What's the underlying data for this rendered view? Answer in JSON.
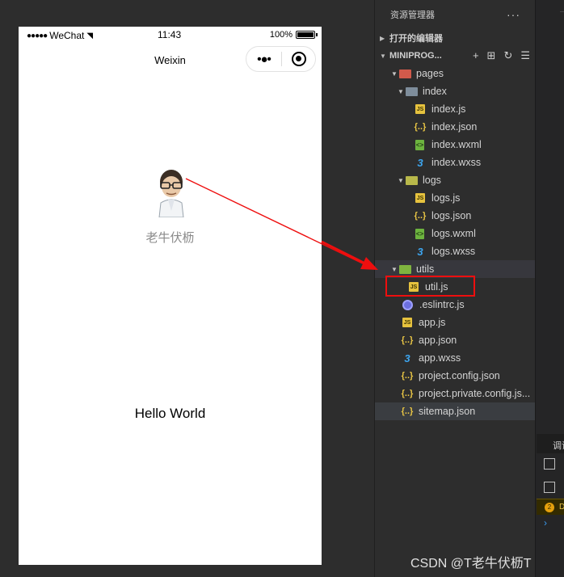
{
  "simulator": {
    "status": {
      "carrier": "WeChat",
      "time": "11:43",
      "battery": "100%"
    },
    "nav_title": "Weixin",
    "nickname": "老牛伏枥",
    "hello": "Hello World"
  },
  "explorer": {
    "title": "资源管理器",
    "more": "···",
    "open_editors": "打开的编辑器",
    "project": "MINIPROG...",
    "items": [
      {
        "label": "pages",
        "icon": "folder-icon"
      },
      {
        "label": "index",
        "icon": "folder-icon"
      },
      {
        "label": "index.js",
        "icon": "js-file-icon"
      },
      {
        "label": "index.json",
        "icon": "json-file-icon"
      },
      {
        "label": "index.wxml",
        "icon": "wxml-file-icon"
      },
      {
        "label": "index.wxss",
        "icon": "wxss-file-icon"
      },
      {
        "label": "logs",
        "icon": "folder-icon"
      },
      {
        "label": "logs.js",
        "icon": "js-file-icon"
      },
      {
        "label": "logs.json",
        "icon": "json-file-icon"
      },
      {
        "label": "logs.wxml",
        "icon": "wxml-file-icon"
      },
      {
        "label": "logs.wxss",
        "icon": "wxss-file-icon"
      },
      {
        "label": "utils",
        "icon": "folder-icon"
      },
      {
        "label": "util.js",
        "icon": "js-file-icon"
      },
      {
        "label": ".eslintrc.js",
        "icon": "eslint-icon"
      },
      {
        "label": "app.js",
        "icon": "js-file-icon"
      },
      {
        "label": "app.json",
        "icon": "json-file-icon"
      },
      {
        "label": "app.wxss",
        "icon": "wxss-file-icon"
      },
      {
        "label": "project.config.json",
        "icon": "json-file-icon"
      },
      {
        "label": "project.private.config.js...",
        "icon": "json-file-icon"
      },
      {
        "label": "sitemap.json",
        "icon": "json-file-icon"
      }
    ]
  },
  "right_panel": {
    "tab": "调试",
    "warning": "D"
  },
  "watermark": "CSDN @T老牛伏枥T",
  "colors": {
    "annotation_red": "#ee0e0e",
    "explorer_bg": "#2d2d2d"
  }
}
